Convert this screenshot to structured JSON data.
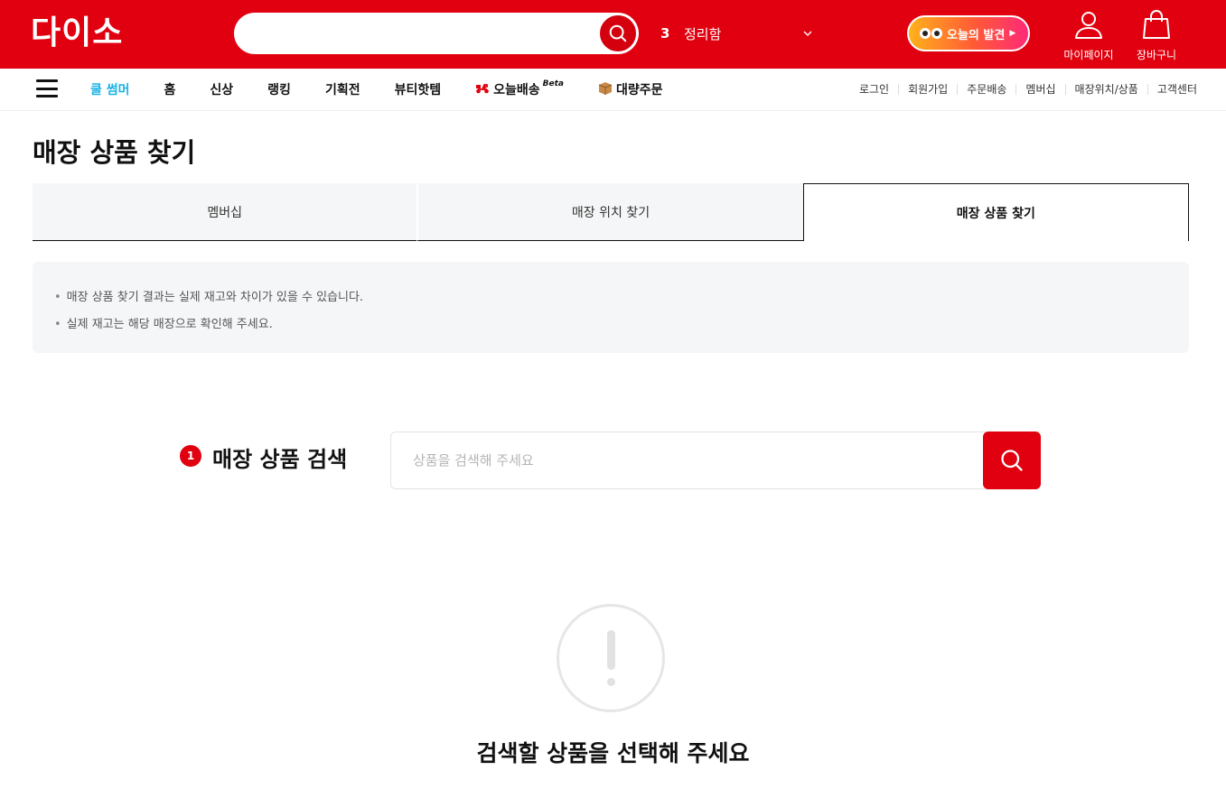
{
  "header": {
    "logo_text": "다이소",
    "search": {
      "placeholder": "",
      "icon": "search-icon"
    },
    "trending": {
      "rank": "3",
      "keyword": "정리함"
    },
    "discover_label": "오늘의 발견",
    "mypage_label": "마이페이지",
    "cart_label": "장바구니",
    "brand_color": "#e0000f"
  },
  "gnb": {
    "menu": [
      {
        "label": "쿨 썸머"
      },
      {
        "label": "홈"
      },
      {
        "label": "신상"
      },
      {
        "label": "랭킹"
      },
      {
        "label": "기획전"
      },
      {
        "label": "뷰티핫템"
      },
      {
        "label": "오늘배송",
        "badge": "Beta",
        "icon": "scooter-icon"
      },
      {
        "label": "대량주문",
        "icon": "box-icon"
      }
    ],
    "utility": [
      "로그인",
      "회원가입",
      "주문배송",
      "멤버십",
      "매장위치/상품",
      "고객센터"
    ]
  },
  "page": {
    "title": "매장 상품 찾기",
    "tabs": [
      {
        "label": "멤버십",
        "active": false
      },
      {
        "label": "매장 위치 찾기",
        "active": false
      },
      {
        "label": "매장 상품 찾기",
        "active": true
      }
    ],
    "notices": [
      "매장 상품 찾기 결과는 실제 재고와 차이가 있을 수 있습니다.",
      "실제 재고는 해당 매장으로 확인해 주세요."
    ],
    "product_search": {
      "step": "1",
      "label": "매장 상품 검색",
      "placeholder": "상품을 검색해 주세요"
    },
    "empty_message": "검색할 상품을 선택해 주세요"
  }
}
